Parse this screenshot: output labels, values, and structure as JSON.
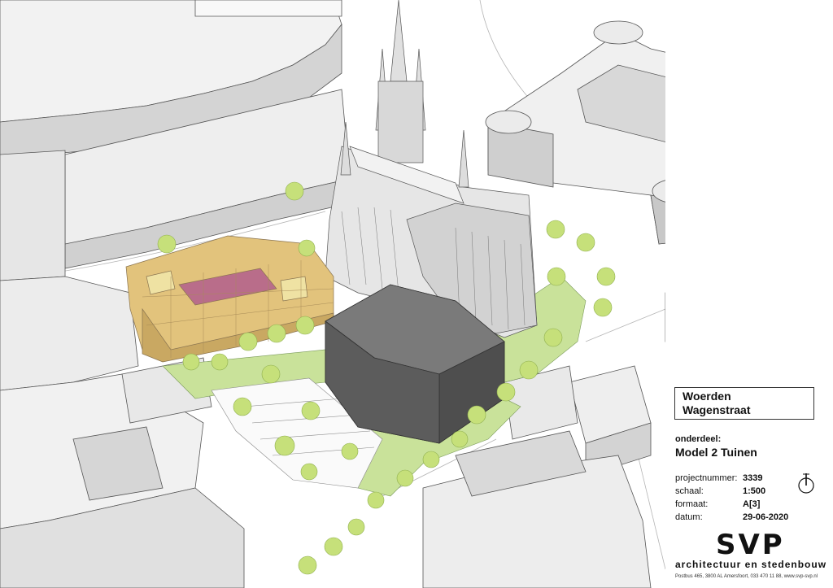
{
  "project": {
    "city": "Woerden",
    "street": "Wagenstraat"
  },
  "part": {
    "label": "onderdeel:",
    "name": "Model 2 Tuinen"
  },
  "meta": {
    "projectnummer_label": "projectnummer:",
    "projectnummer": "3339",
    "schaal_label": "schaal:",
    "schaal": "1:500",
    "formaat_label": "formaat:",
    "formaat": "A[3]",
    "datum_label": "datum:",
    "datum": "29-06-2020"
  },
  "firm": {
    "logo": "SVP",
    "tagline": "architectuur en stedenbouw",
    "address": "Postbus 465, 3800 AL Amersfoort, 033 470 11 88, www.svp-svp.nl"
  },
  "colors": {
    "existing_building": "#e8e8e8",
    "new_housing": "#e2c37c",
    "new_volume": "#5a5a5a",
    "garden": "#c9e29a",
    "tree": "#c6e07a",
    "church": "#d9d9d9"
  },
  "icons": {
    "north_arrow": "north-arrow-icon"
  }
}
